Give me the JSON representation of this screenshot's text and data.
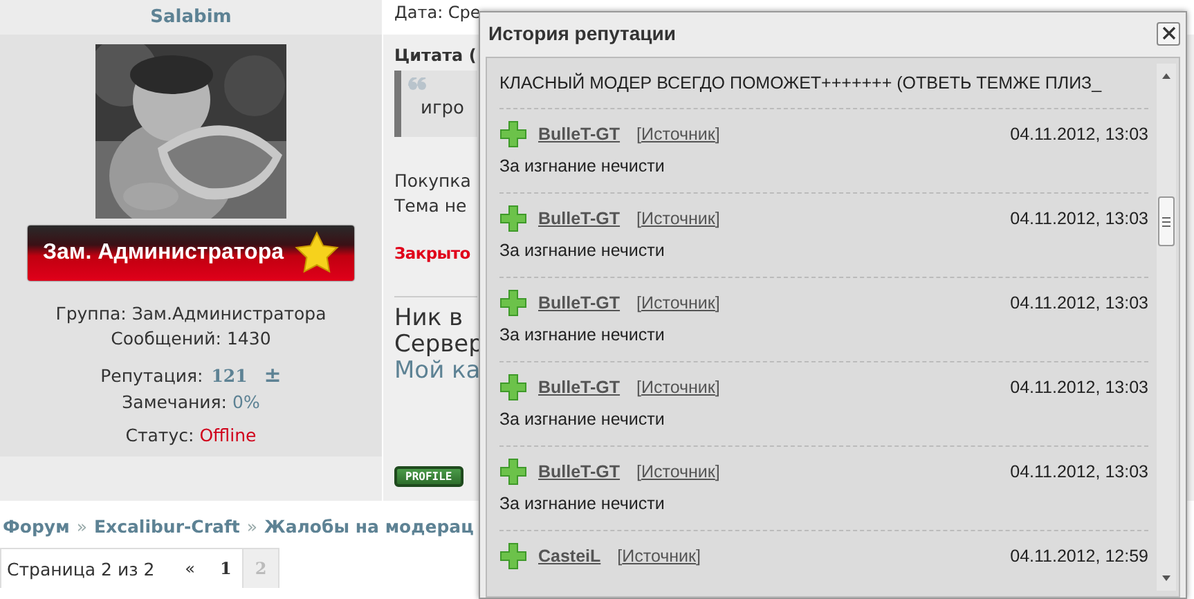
{
  "user": {
    "name": "Salabim",
    "rank": "Зам. Администратора",
    "group": "Группа: Зам.Администратора",
    "posts": "Сообщений: 1430",
    "reputation_label": "Репутация:",
    "reputation": "121",
    "reputation_sign": "±",
    "warnings_label": "Замечания:",
    "warnings": "0%",
    "status_label": "Статус:",
    "status": "Offline",
    "profile_button": "PROFILE"
  },
  "post": {
    "date": "Дата: Сре",
    "quote_title": "Цитата (",
    "quote_text": "игро",
    "lines": [
      "Покупка",
      "Тема не"
    ],
    "closed": "Закрыто",
    "sig_lines": [
      "Ник в",
      "Сервер"
    ],
    "sig_link": "Мой ка"
  },
  "breadcrumb": [
    "Форум",
    "Excalibur-Craft",
    "Жалобы на модерац"
  ],
  "breadcrumb_sep": "»",
  "pagination": {
    "label": "Страница 2 из 2",
    "prev": "«",
    "pages": [
      {
        "label": "1",
        "selected": false
      },
      {
        "label": "2",
        "selected": true
      }
    ]
  },
  "dialog": {
    "title": "История репутации",
    "top_comment": "КЛАСНЫЙ МОДЕР ВСЕГДО ПОМОЖЕТ+++++++ (ОТВЕТЬ ТЕМЖЕ ПЛИЗ_",
    "entries": [
      {
        "user": "BulleT-GT",
        "source": "[Источник]",
        "date": "04.11.2012, 13:03",
        "comment": "За изгнание нечисти"
      },
      {
        "user": "BulleT-GT",
        "source": "[Источник]",
        "date": "04.11.2012, 13:03",
        "comment": "За изгнание нечисти"
      },
      {
        "user": "BulleT-GT",
        "source": "[Источник]",
        "date": "04.11.2012, 13:03",
        "comment": "За изгнание нечисти"
      },
      {
        "user": "BulleT-GT",
        "source": "[Источник]",
        "date": "04.11.2012, 13:03",
        "comment": "За изгнание нечисти"
      },
      {
        "user": "BulleT-GT",
        "source": "[Источник]",
        "date": "04.11.2012, 13:03",
        "comment": "За изгнание нечисти"
      },
      {
        "user": "CasteiL",
        "source": "[Источник]",
        "date": "04.11.2012, 12:59"
      }
    ]
  }
}
